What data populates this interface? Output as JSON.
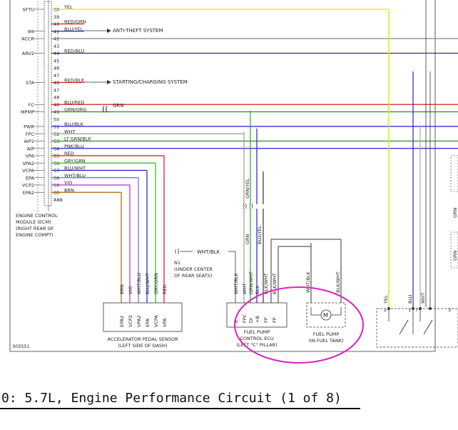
{
  "caption": "0: 5.7L, Engine Performance Circuit (1 of 8)",
  "figure_id": "305551",
  "ecm": {
    "label_lines": [
      "ENGINE CONTROL",
      "MODULE (ECM)",
      "(RIGHT REAR OF",
      "ENGINE COMPT)"
    ],
    "rows": [
      {
        "sig": "SFTU",
        "pin": "38",
        "wire": "YEL",
        "color": "#e6e600"
      },
      {
        "sig": "",
        "pin": "39",
        "wire": "",
        "color": ""
      },
      {
        "sig": "",
        "pin": "40",
        "wire": "RED/GRN",
        "color": "#cc2222"
      },
      {
        "sig": "IMI",
        "pin": "41",
        "wire": "BLU/YEL",
        "color": "#2222cc"
      },
      {
        "sig": "ACCR",
        "pin": "42",
        "wire": "",
        "color": "#888888"
      },
      {
        "sig": "",
        "pin": "43",
        "wire": "",
        "color": ""
      },
      {
        "sig": "ARV2",
        "pin": "44",
        "wire": "RED/BLU",
        "color": "#4422aa"
      },
      {
        "sig": "",
        "pin": "45",
        "wire": "",
        "color": ""
      },
      {
        "sig": "",
        "pin": "46",
        "wire": "",
        "color": ""
      },
      {
        "sig": "",
        "pin": "47",
        "wire": "",
        "color": ""
      },
      {
        "sig": "STA",
        "pin": "48",
        "wire": "RED/BLK",
        "color": "#cc2222"
      },
      {
        "sig": "",
        "pin": "47",
        "wire": "",
        "color": ""
      },
      {
        "sig": "",
        "pin": "48",
        "wire": "",
        "color": ""
      },
      {
        "sig": "FC",
        "pin": "48",
        "wire": "BLU/RED",
        "color": "#cc2222"
      },
      {
        "sig": "MPMP",
        "pin": "49",
        "wire": "GRN/ORG",
        "color": "#22aa22"
      },
      {
        "sig": "",
        "pin": "50",
        "wire": "",
        "color": ""
      },
      {
        "sig": "PWR",
        "pin": "51",
        "wire": "BLU/BLK",
        "color": "#2222cc"
      },
      {
        "sig": "FPC",
        "pin": "52",
        "wire": "WHT",
        "color": "#999999"
      },
      {
        "sig": "AIP2",
        "pin": "53",
        "wire": "LT GRN/BLK",
        "color": "#229922"
      },
      {
        "sig": "AIP",
        "pin": "54",
        "wire": "PNK/BLU",
        "color": "#2222cc"
      },
      {
        "sig": "VPA",
        "pin": "55",
        "wire": "RED",
        "color": "#dd1111"
      },
      {
        "sig": "VPA2",
        "pin": "56",
        "wire": "GRY/GRN",
        "color": "#22bb22"
      },
      {
        "sig": "VCPA",
        "pin": "57",
        "wire": "BLU/WHT",
        "color": "#2222cc"
      },
      {
        "sig": "EPA",
        "pin": "58",
        "wire": "WHT/BLU",
        "color": "#6666dd"
      },
      {
        "sig": "VCP2",
        "pin": "59",
        "wire": "VIO",
        "color": "#cc22cc"
      },
      {
        "sig": "EPA2",
        "pin": "60",
        "wire": "BRN",
        "color": "#aa6600"
      },
      {
        "sig": "",
        "pin": "A88",
        "wire": "",
        "color": ""
      }
    ]
  },
  "annotations": {
    "anti_theft": "ANTI-THEFT SYSTEM",
    "starting_charging": "STARTING/CHARGING SYSTEM",
    "grn_label": "GRN",
    "wht_blk_top": "WHT/BLK",
    "ground_id": "N1",
    "ground_lines": [
      "(UNDER CENTER",
      "OF REAR SEATS)"
    ]
  },
  "pedal_sensor": {
    "label_lines": [
      "ACCELERATOR PEDAL SENSOR",
      "(LEFT SIDE OF DASH)"
    ],
    "wires": [
      "BRN",
      "VIO",
      "WHT/BLU",
      "BLU/WHT",
      "GRY/GRN",
      "RED"
    ],
    "pins": [
      "EPA2",
      "VCP2",
      "VPA2",
      "EPA",
      "VCPA",
      "VPA"
    ]
  },
  "fuel_pump_ecu": {
    "label_lines": [
      "FUEL PUMP",
      "CONTROL ECU",
      "(LEFT \"C\" PILLAR)"
    ],
    "wires": [
      "WHT/BLK",
      "WHT",
      "GRN/WHT",
      "BLK",
      "BLK/WHT",
      "BLK/WHT"
    ],
    "pins": [
      "E",
      "FPC",
      "DI",
      "+B",
      "FP",
      "FP"
    ],
    "vert_wires": [
      "GRN/YEL",
      "GRN",
      "BLU/YEL"
    ]
  },
  "fuel_pump": {
    "label_lines": [
      "FUEL PUMP",
      "(IN FUEL TANK)"
    ],
    "wires": [
      "WHT/BLK",
      "BLK/WHT"
    ]
  },
  "right_side": {
    "labels": [
      "YEL",
      "BLU",
      "WHT",
      "GRN",
      "GRN"
    ],
    "pins": [
      "2",
      "1",
      "7",
      "3"
    ]
  },
  "colors": {
    "highlight": "#e020c0",
    "yel": "#e6e600",
    "red": "#dd1111",
    "grn": "#22aa22",
    "blu": "#2222cc"
  }
}
